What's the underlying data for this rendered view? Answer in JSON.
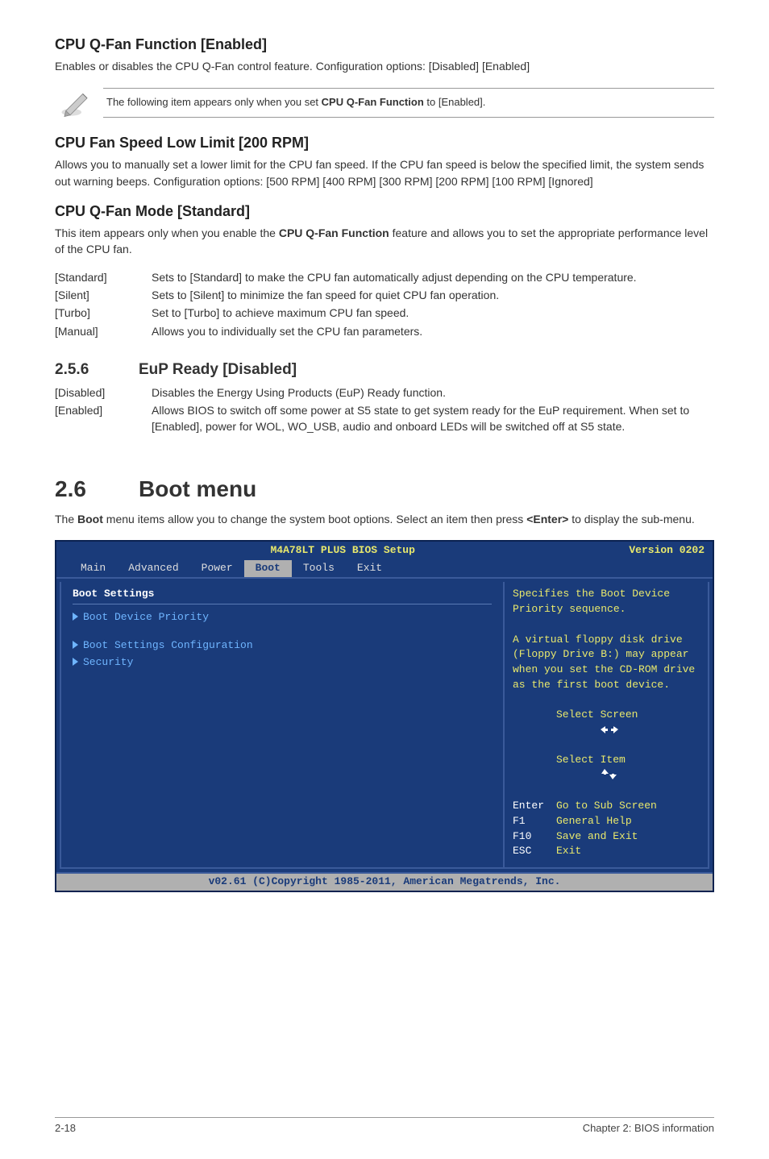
{
  "section1": {
    "title": "CPU Q-Fan Function [Enabled]",
    "body": "Enables or disables the CPU Q-Fan control feature. Configuration options: [Disabled] [Enabled]"
  },
  "note": {
    "text_before": "The following item appears only when you set ",
    "bold": "CPU Q-Fan Function",
    "text_after": " to [Enabled]."
  },
  "section2": {
    "title": "CPU Fan Speed Low Limit [200 RPM]",
    "body": "Allows you to manually set a lower limit for the CPU fan speed. If the CPU fan speed is below the specified limit, the system sends out warning beeps. Configuration options: [500 RPM] [400 RPM] [300 RPM] [200 RPM] [100 RPM] [Ignored]"
  },
  "section3": {
    "title": "CPU Q-Fan Mode [Standard]",
    "body_before": "This item appears only when you enable the ",
    "body_bold": "CPU Q-Fan Function",
    "body_after": " feature and allows you to set the appropriate performance level of the CPU fan.",
    "options": [
      {
        "key": "[Standard]",
        "desc": "Sets to [Standard] to make the CPU fan automatically adjust depending on the CPU temperature."
      },
      {
        "key": "[Silent]",
        "desc": "Sets to [Silent] to minimize the fan speed for quiet CPU fan operation."
      },
      {
        "key": "[Turbo]",
        "desc": "Set to [Turbo] to achieve maximum CPU fan speed."
      },
      {
        "key": "[Manual]",
        "desc": "Allows you to individually set the CPU fan parameters."
      }
    ]
  },
  "section256": {
    "num": "2.5.6",
    "title": "EuP Ready [Disabled]",
    "options": [
      {
        "key": "[Disabled]",
        "desc": "Disables the Energy Using Products (EuP) Ready function."
      },
      {
        "key": "[Enabled]",
        "desc": "Allows BIOS to switch off some power at S5 state to get system ready for the EuP requirement. When set to [Enabled], power for WOL, WO_USB, audio and onboard LEDs will be switched off at S5 state."
      }
    ]
  },
  "section26": {
    "num": "2.6",
    "title": "Boot menu",
    "body_before": "The ",
    "body_bold1": "Boot",
    "body_mid": " menu items allow you to change the system boot options. Select an item then press ",
    "body_bold2": "<Enter>",
    "body_after": " to display the sub-menu."
  },
  "bios": {
    "product_title": "M4A78LT PLUS BIOS Setup",
    "version": "Version 0202",
    "tabs": [
      "Main",
      "Advanced",
      "Power",
      "Boot",
      "Tools",
      "Exit"
    ],
    "active_tab_index": 3,
    "left": {
      "group": "Boot Settings",
      "items": [
        "Boot Device Priority",
        "Boot Settings Configuration",
        "Security"
      ]
    },
    "right": {
      "help": "Specifies the Boot Device Priority sequence.\n\nA virtual floppy disk drive (Floppy Drive B:) may appear when you set the CD-ROM drive as the first boot device.",
      "keys": [
        {
          "k": "↔",
          "d": "Select Screen"
        },
        {
          "k": "↕",
          "d": "Select Item"
        },
        {
          "k": "Enter",
          "d": "Go to Sub Screen"
        },
        {
          "k": "F1",
          "d": "General Help"
        },
        {
          "k": "F10",
          "d": "Save and Exit"
        },
        {
          "k": "ESC",
          "d": "Exit"
        }
      ]
    },
    "footer": "v02.61 (C)Copyright 1985-2011, American Megatrends, Inc."
  },
  "footer": {
    "left": "2-18",
    "right": "Chapter 2: BIOS information"
  }
}
